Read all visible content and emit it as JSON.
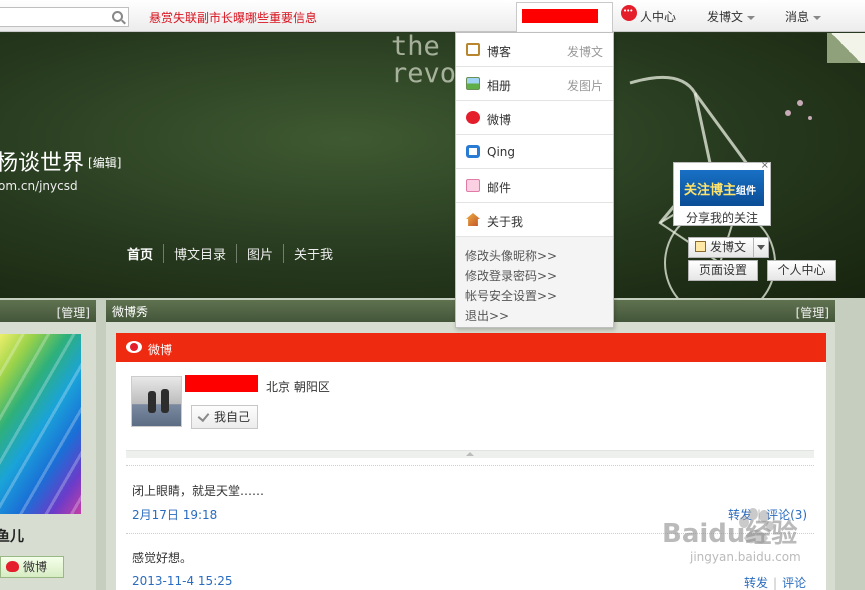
{
  "topbar": {
    "search_placeholder": "",
    "news": "悬赏失联副市长曝哪些重要信息",
    "profile_label": "人中心",
    "post_label": "发博文",
    "message_label": "消息"
  },
  "dropdown": {
    "items": [
      {
        "label": "博客",
        "right": "发博文",
        "icon": "blog-icon"
      },
      {
        "label": "相册",
        "right": "发图片",
        "icon": "album-icon"
      },
      {
        "label": "微博",
        "right": "",
        "icon": "weibo-icon"
      },
      {
        "label": "Qing",
        "right": "",
        "icon": "qing-icon"
      },
      {
        "label": "邮件",
        "right": "",
        "icon": "mail-icon"
      },
      {
        "label": "关于我",
        "right": "",
        "icon": "home-icon"
      }
    ],
    "links": [
      "修改头像昵称>>",
      "修改登录密码>>",
      "帐号安全设置>>",
      "退出>>"
    ]
  },
  "banner": {
    "text_line1": "the w",
    "text_line2": "revo",
    "blog_title": "杨谈世界",
    "edit_label": "[编辑]",
    "blog_url": "om.cn/jnycsd"
  },
  "nav": [
    "首页",
    "博文目录",
    "图片",
    "关于我"
  ],
  "follow_widget": {
    "banner_main": "关注博主",
    "banner_small": "组件",
    "text": "分享我的关注",
    "close": "×"
  },
  "buttons": {
    "post": "发博文",
    "page_settings": "页面设置",
    "personal_center": "个人中心"
  },
  "left_col": {
    "manage": "[管理]",
    "name": "鱼儿",
    "weibo_button": "微博"
  },
  "main_col": {
    "title": "微博秀",
    "manage": "[管理]",
    "header": "微博",
    "location": "北京 朝阳区",
    "self_button": "我自己",
    "posts": [
      {
        "text": "闭上眼睛，就是天堂……",
        "time": "2月17日 19:18",
        "repost": "转发",
        "comment": "评论(3)"
      },
      {
        "text": "感觉好想。",
        "time": "2013-11-4 15:25",
        "repost": "转发",
        "comment": "评论"
      }
    ]
  },
  "watermark": {
    "main": "Baidu经验",
    "sub": "jingyan.baidu.com"
  },
  "colors": {
    "accent_red": "#ee2a11",
    "link_blue": "#2a6cbf",
    "news_red": "#d8131f"
  }
}
